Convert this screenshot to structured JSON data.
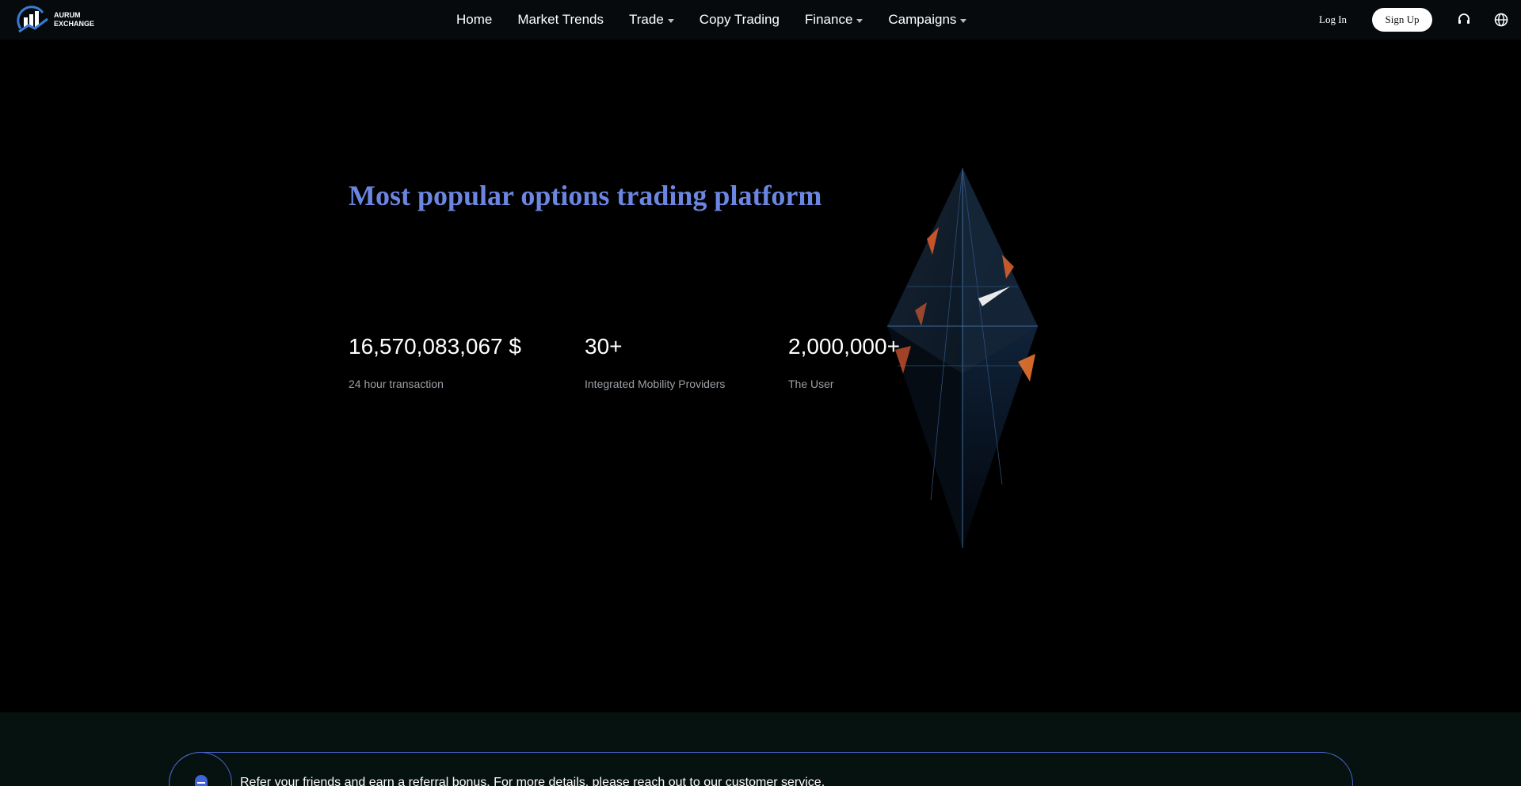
{
  "header": {
    "logo": {
      "line1": "AURUM",
      "line2": "EXCHANGE"
    },
    "nav": [
      {
        "label": "Home",
        "dropdown": false
      },
      {
        "label": "Market Trends",
        "dropdown": false
      },
      {
        "label": "Trade",
        "dropdown": true
      },
      {
        "label": "Copy Trading",
        "dropdown": false
      },
      {
        "label": "Finance",
        "dropdown": true
      },
      {
        "label": "Campaigns",
        "dropdown": true
      }
    ],
    "login_label": "Log In",
    "signup_label": "Sign Up",
    "icons": [
      "headset-icon",
      "globe-icon"
    ]
  },
  "hero": {
    "title": "Most popular options trading platform",
    "stats": [
      {
        "value": "16,570,083,067 $",
        "label": "24 hour transaction"
      },
      {
        "value": "30+",
        "label": "Integrated Mobility Providers"
      },
      {
        "value": "2,000,000+",
        "label": "The User"
      }
    ]
  },
  "notice": {
    "text": "Refer your friends and earn a referral bonus. For more details, please reach out to our customer service.",
    "icon": "bell-icon"
  },
  "colors": {
    "accent": "#6b86e0",
    "border": "#4a63c8",
    "background": "#000000",
    "band": "#06120f"
  }
}
